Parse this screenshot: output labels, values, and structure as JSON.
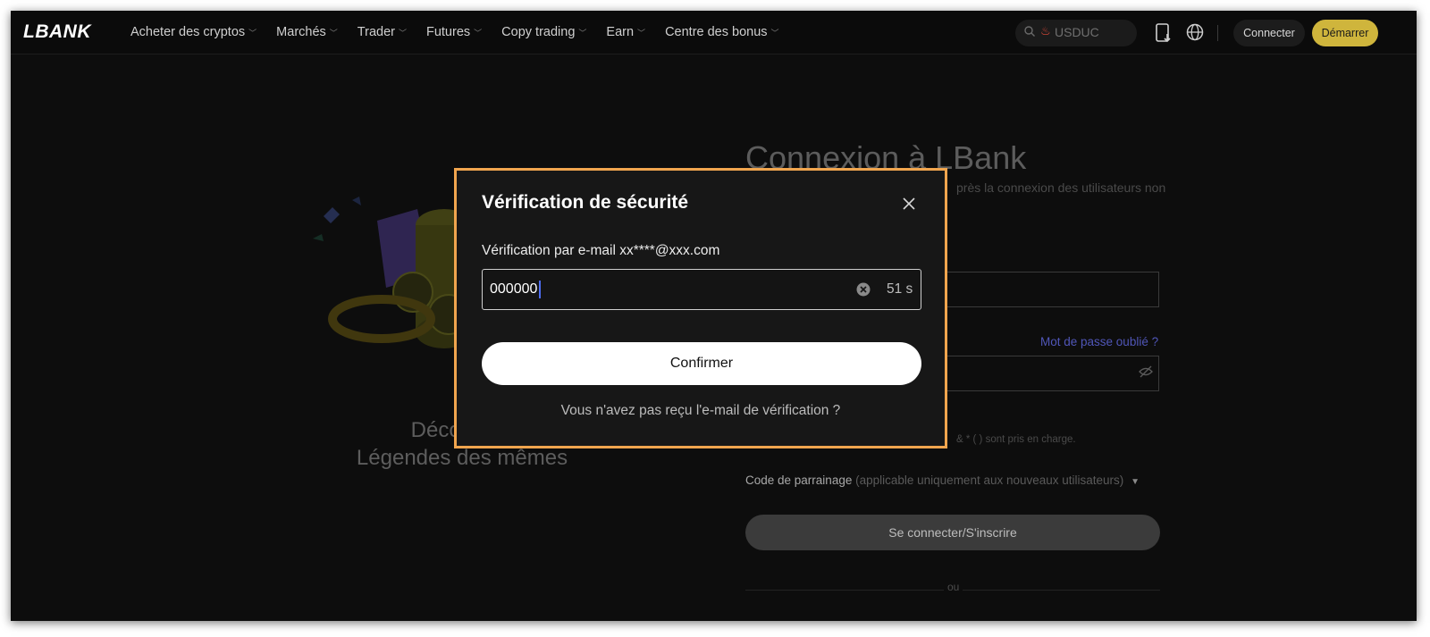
{
  "nav": {
    "logo": "LBANK",
    "menu": [
      {
        "label": "Acheter des cryptos"
      },
      {
        "label": "Marchés"
      },
      {
        "label": "Trader"
      },
      {
        "label": "Futures"
      },
      {
        "label": "Copy trading"
      },
      {
        "label": "Earn"
      },
      {
        "label": "Centre des bonus"
      }
    ],
    "search_text": "USDUC",
    "connect_label": "Connecter",
    "start_label": "Démarrer"
  },
  "background": {
    "promo_line1": "Découvrez",
    "promo_line2": "Légendes des mêmes",
    "login_title": "Connexion à LBank",
    "login_sub": "près la connexion des utilisateurs non",
    "forgot_password": "Mot de passe oublié ?",
    "password_hint": "& * ( ) sont pris en charge.",
    "referral_label": "Code de parrainage",
    "referral_note": "(applicable uniquement aux nouveaux utilisateurs)",
    "login_button": "Se connecter/S'inscrire",
    "or": "ou"
  },
  "dialog": {
    "title": "Vérification de sécurité",
    "email_label": "Vérification par e-mail xx****@xxx.com",
    "code_value": "000000",
    "timer": "51 s",
    "confirm_label": "Confirmer",
    "resend_label": "Vous n'avez pas reçu l'e-mail de vérification ?"
  },
  "colors": {
    "accent_gold": "#cfb53c",
    "highlight_border": "#f0a54e",
    "link": "#5056b8",
    "caret": "#4d6cf0"
  },
  "icons": {
    "search": "search-icon",
    "fire": "fire-icon",
    "download": "download-icon",
    "globe": "globe-icon",
    "close": "close-icon",
    "clear": "clear-icon",
    "eye": "eye-slash-icon"
  }
}
